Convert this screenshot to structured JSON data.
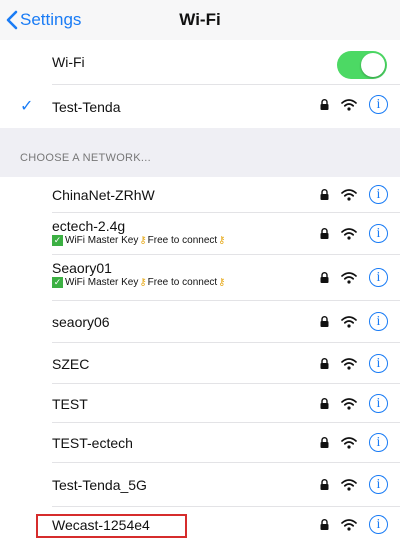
{
  "navbar": {
    "back_label": "Settings",
    "title": "Wi-Fi"
  },
  "wifi_toggle": {
    "label": "Wi-Fi",
    "state": "on",
    "color": "#4cd964"
  },
  "connected": {
    "name": "Test-Tenda",
    "secured": true
  },
  "section": {
    "header": "CHOOSE A NETWORK..."
  },
  "networks": [
    {
      "name": "ChinaNet-ZRhW",
      "sub": null
    },
    {
      "name": "ectech-2.4g",
      "sub": {
        "a": "WiFi Master Key",
        "b": "Free to connect"
      }
    },
    {
      "name": "Seaory01",
      "sub": {
        "a": "WiFi Master Key",
        "b": "Free to connect"
      }
    },
    {
      "name": "seaory06",
      "sub": null
    },
    {
      "name": "SZEC",
      "sub": null
    },
    {
      "name": "TEST",
      "sub": null
    },
    {
      "name": "TEST-ectech",
      "sub": null
    },
    {
      "name": "Test-Tenda_5G",
      "sub": null
    },
    {
      "name": "Wecast-1254e4",
      "sub": null,
      "highlighted": true
    }
  ],
  "colors": {
    "accent": "#1a7cf5",
    "highlight_border": "#d62c2c"
  }
}
